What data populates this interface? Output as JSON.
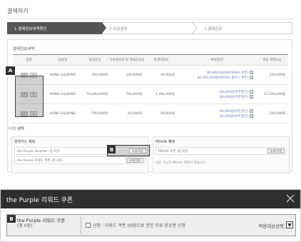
{
  "page": {
    "title": "결제하기",
    "steps": [
      {
        "label": "1  결제정보내역확인",
        "active": true
      },
      {
        "label": "2  요금결제",
        "active": false
      },
      {
        "label": "3  결제완료",
        "active": false
      }
    ]
  },
  "payment_info": {
    "section_title": "결제정보내역",
    "columns": [
      "분반",
      "탑승객",
      "항공운임",
      "유류할증료 및 제세공과금",
      "발권대행료",
      "혜택/할인",
      "최종 결제요금"
    ],
    "rows": [
      {
        "select": [
          "Y",
          "N"
        ],
        "passenger": "HONG GILDONG",
        "fare": "700,000원",
        "tax": "200,000원",
        "fee": "49,000원",
        "benefits": [
          "80,900,000원(PRIVIA 쿠폰)",
          "80,900,000원(PRIVIA 플러스 쿠폰)"
        ],
        "total": "249,000원"
      },
      {
        "select": [
          "Y",
          "N"
        ],
        "passenger": "HONG GILDONG",
        "fare": "70,000,000원",
        "tax": "700,000원",
        "fee": "1,490,000원",
        "benefits": [
          "00,000원(쿠폰할인)",
          "00,000원(쿠폰할인)"
        ],
        "total": "17,249,000원"
      },
      {
        "select": [
          "Y",
          "N"
        ],
        "passenger": "HONG GILDONG",
        "fare": "700,000원",
        "tax": "85,000원",
        "fee": "49,000원",
        "benefits": [
          "00,000원(쿠폰할인)",
          "00,000원(쿠폰할인)"
        ],
        "total": "249,000원"
      }
    ]
  },
  "my_benefits": {
    "section_title": "나의 혜택",
    "hyundai": {
      "title": "현대카드 혜택",
      "rows": [
        {
          "label": "the Purple Voucher (총 0장)",
          "button": ""
        },
        {
          "label": "the Purple 리워드 쿠폰 (총 0장)",
          "button": "조회/적용"
        }
      ]
    },
    "privia": {
      "title": "PRIVIA 혜택",
      "rows": [
        {
          "label": "PRIVIA 쿠폰 (총 0장)",
          "button": "조회/적용"
        }
      ],
      "note": "사용 가능한 PRIVIA 혜택이 없습니다."
    },
    "highlight_button": "조회/적용"
  },
  "markers": {
    "a": "A",
    "b": "B"
  },
  "modal": {
    "title": "the Purple 리워드 쿠폰",
    "coupon_name": "the Purple 리워드 쿠폰",
    "coupon_count": "(총 0장)",
    "description": "신청 : 리워드 쿠폰 00장으로 본인 무료 항공권 신청",
    "select_label": "적용대상선택"
  }
}
